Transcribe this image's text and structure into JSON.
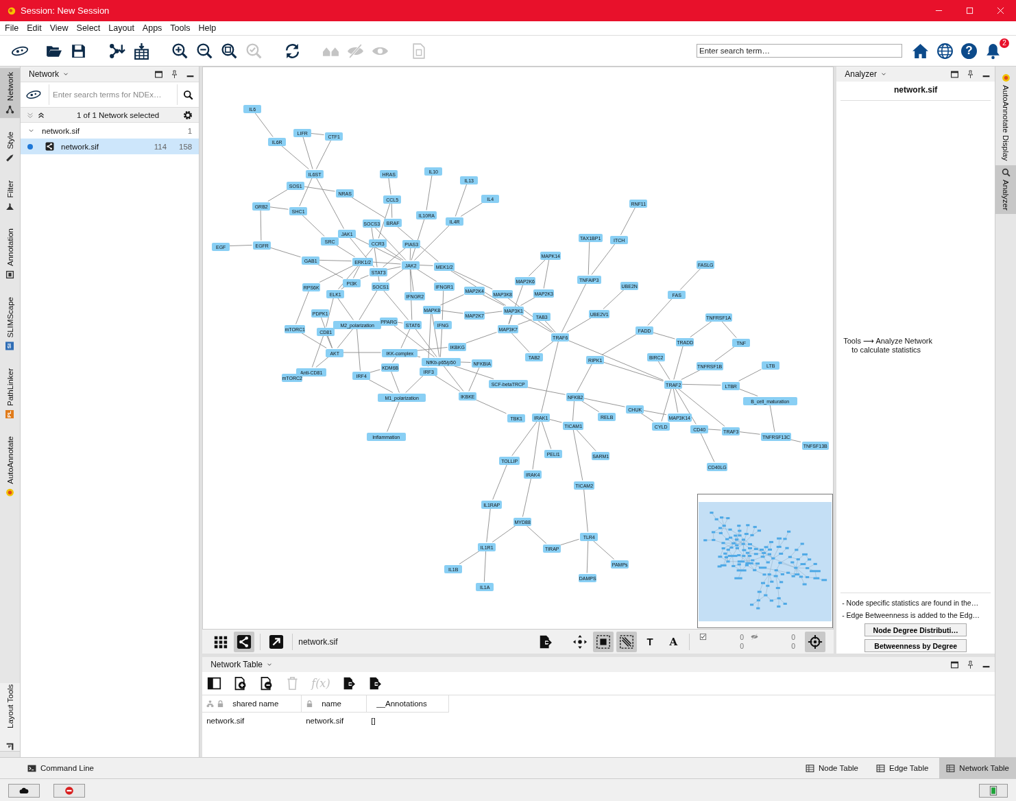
{
  "window": {
    "title": "Session: New Session"
  },
  "menu": [
    "File",
    "Edit",
    "View",
    "Select",
    "Layout",
    "Apps",
    "Tools",
    "Help"
  ],
  "toolbar": {
    "buttons": [
      {
        "kind": "logo",
        "disabled": false
      },
      {
        "kind": "open",
        "disabled": false
      },
      {
        "kind": "save",
        "disabled": false
      },
      {
        "kind": "import-network",
        "disabled": false
      },
      {
        "kind": "import-table",
        "disabled": false
      },
      {
        "kind": "zoom-in",
        "disabled": false
      },
      {
        "kind": "zoom-out",
        "disabled": false
      },
      {
        "kind": "zoom-fit",
        "disabled": false
      },
      {
        "kind": "zoom-selected",
        "disabled": true
      },
      {
        "kind": "refresh",
        "disabled": false
      },
      {
        "kind": "neighbors",
        "disabled": true
      },
      {
        "kind": "hide",
        "disabled": true
      },
      {
        "kind": "show",
        "disabled": true
      },
      {
        "kind": "export-image",
        "disabled": true
      }
    ],
    "search": {
      "placeholder": "Enter search term…"
    },
    "help_glyph": "?",
    "notifications": "2"
  },
  "left_tabs": [
    {
      "label": "Network",
      "selected": true,
      "kind": "network"
    },
    {
      "label": "Style",
      "selected": false,
      "kind": "style"
    },
    {
      "label": "Filter",
      "selected": false,
      "kind": "filter"
    },
    {
      "label": "Annotation",
      "selected": false,
      "kind": "annotation"
    },
    {
      "label": "SLIMScape",
      "selected": false,
      "kind": "badge",
      "badge": "Sl",
      "color": "#2f6db5"
    },
    {
      "label": "PathLinker",
      "selected": false,
      "kind": "badge",
      "badge": "PL",
      "color": "#e07b1a"
    },
    {
      "label": "AutoAnnotate",
      "selected": false,
      "kind": "autoannotate"
    },
    {
      "label": "Layout Tools",
      "selected": false,
      "kind": "layout"
    }
  ],
  "network_panel": {
    "title": "Network",
    "search_placeholder": "Enter search terms for NDEx…",
    "selection_status": "1 of 1 Network selected",
    "collections": [
      {
        "name": "network.sif",
        "count": "1",
        "expanded": true,
        "networks": [
          {
            "name": "network.sif",
            "nodes": "114",
            "edges": "158",
            "selected": true
          }
        ]
      }
    ]
  },
  "canvas": {
    "nodes": [
      "IL6",
      "IL6R",
      "LIFR",
      "CTF1",
      "IL6ST",
      "SOS1",
      "NRAS",
      "GRB2",
      "SHC1",
      "EGF",
      "EGFR",
      "SRC",
      "JAK1",
      "SOCS3",
      "BRAF",
      "HRAS",
      "CCL5",
      "CCR3",
      "PIAS3",
      "IL10",
      "IL13",
      "IL4",
      "IL10RA",
      "IL4R",
      "GAB1",
      "ERK1/2",
      "JAK2",
      "MEK1/2",
      "STAT3",
      "RPS6K",
      "PI3K",
      "SOCS1",
      "ELK1",
      "IFNGR2",
      "IFNGR1",
      "PDPK1",
      "M2_polarization",
      "PPARG",
      "STAT6",
      "MAPK8",
      "IFNG",
      "mTORC1",
      "CD81",
      "AKT",
      "IKK-complex",
      "IKBKG",
      "NfKb-p65/p50",
      "NFKBIA",
      "IRF3",
      "KDM6B",
      "IRF4",
      "Anti-CD81",
      "mTORC2",
      "SCF-betaTRCP",
      "M1_polarization",
      "IKBKE",
      "Inflammation",
      "MAP2K4",
      "MAP3K8",
      "MAP2K6",
      "MAPK14",
      "MAP2K3",
      "MAP2K7",
      "MAP3K1",
      "TAB3",
      "MAP3K7",
      "TAB2",
      "TRAF6",
      "TAX1BP1",
      "ITCH",
      "RNF11",
      "TNFAIP3",
      "UBE2N",
      "UBE2V1",
      "FASLG",
      "FAS",
      "FADD",
      "TNFRSF1A",
      "TRADD",
      "TNF",
      "BIRC2",
      "RIPK1",
      "TNFRSF1B",
      "LTB",
      "TRAF2",
      "LTBR",
      "B_cell_maturation",
      "NFKB2",
      "CHUK",
      "RELB",
      "MAP3K14",
      "CYLD",
      "CD40",
      "TRAF3",
      "TNFRSF13C",
      "TNFSF13B",
      "CD40LG",
      "TBK1",
      "IRAK1",
      "TICAM1",
      "PELI1",
      "SARM1",
      "TOLLIP",
      "IRAK4",
      "TICAM2",
      "IL1RAP",
      "MYD88",
      "TLR4",
      "IL1R1",
      "TIRAP",
      "PAMPs",
      "IL1B",
      "DAMPS",
      "IL1A"
    ],
    "view_toolbar": {
      "modes": [
        {
          "kind": "grid",
          "selected": false
        },
        {
          "kind": "network",
          "selected": true
        }
      ],
      "network_name": "network.sif",
      "tools": [
        {
          "kind": "export",
          "selected": false
        },
        {
          "kind": "move",
          "selected": false
        },
        {
          "kind": "select-nodes",
          "selected": true
        },
        {
          "kind": "select-edges",
          "selected": true
        },
        {
          "kind": "annotation",
          "glyph": "T",
          "selected": false
        },
        {
          "kind": "text",
          "glyph": "A",
          "selected": false
        }
      ],
      "selection_counts": [
        "0",
        "0"
      ],
      "hidden_counts": [
        "0",
        "0"
      ]
    }
  },
  "analyzer_panel": {
    "title": "Analyzer",
    "network": "network.sif",
    "hint": [
      "Tools ⟶ Analyze Network",
      "to calculate statistics"
    ],
    "notes": [
      "- Node specific statistics are found in the…",
      "- Edge Betweenness is added to the Edg…"
    ],
    "buttons": [
      "Node Degree Distributi…",
      "Betweenness by Degree"
    ]
  },
  "right_tabs": [
    {
      "label": "AutoAnnotate Display",
      "selected": false
    },
    {
      "label": "Analyzer",
      "selected": true
    }
  ],
  "table_panel": {
    "title": "Network Table",
    "tools": [
      {
        "kind": "columns",
        "disabled": false
      },
      {
        "kind": "add-column",
        "disabled": false
      },
      {
        "kind": "remove-column",
        "disabled": false
      },
      {
        "kind": "delete",
        "disabled": true
      },
      {
        "kind": "function",
        "glyph": "f(x)",
        "disabled": true
      },
      {
        "kind": "import",
        "disabled": false
      },
      {
        "kind": "export",
        "disabled": false
      }
    ],
    "columns": [
      {
        "label": "shared name",
        "kind": "shared"
      },
      {
        "label": "name",
        "kind": "locked"
      },
      {
        "label": "__Annotations",
        "kind": "plain"
      }
    ],
    "rows": [
      [
        "network.sif",
        "network.sif",
        "[]"
      ]
    ]
  },
  "status_bar": {
    "command_line": "Command Line",
    "tabs": [
      {
        "label": "Node Table",
        "selected": false
      },
      {
        "label": "Edge Table",
        "selected": false
      },
      {
        "label": "Network Table",
        "selected": true
      }
    ]
  }
}
